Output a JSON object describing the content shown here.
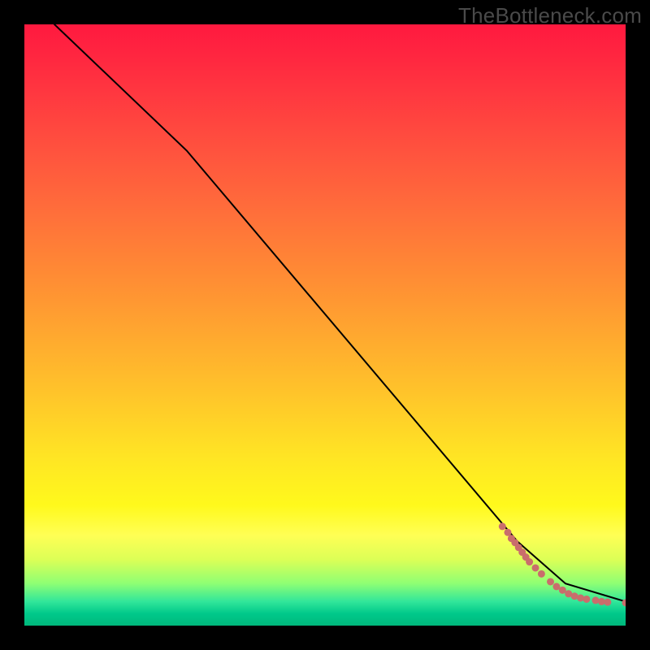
{
  "watermark": "TheBottleneck.com",
  "chart_data": {
    "type": "line",
    "title": "",
    "xlabel": "",
    "ylabel": "",
    "xlim": [
      0,
      100
    ],
    "ylim": [
      0,
      100
    ],
    "grid": false,
    "legend": false,
    "background_gradient": {
      "stops": [
        {
          "pos": 0.0,
          "color": "#ff193f"
        },
        {
          "pos": 0.18,
          "color": "#ff4a3f"
        },
        {
          "pos": 0.42,
          "color": "#ff8c34"
        },
        {
          "pos": 0.72,
          "color": "#ffe524"
        },
        {
          "pos": 0.85,
          "color": "#ffff55"
        },
        {
          "pos": 0.96,
          "color": "#31e69a"
        },
        {
          "pos": 1.0,
          "color": "#00b87c"
        }
      ]
    },
    "series": [
      {
        "name": "curve",
        "style": "line",
        "color": "#000000",
        "x": [
          5,
          27,
          82,
          90,
          100
        ],
        "y": [
          100,
          79,
          14,
          7,
          4
        ]
      },
      {
        "name": "bottleneck-points",
        "style": "scatter",
        "color": "#c96d6c",
        "marker_size": 9,
        "x": [
          79.5,
          80.4,
          81.0,
          81.6,
          82.2,
          82.8,
          83.4,
          84.0,
          85.0,
          86.0,
          87.5,
          88.5,
          89.5,
          90.5,
          91.5,
          92.5,
          93.5,
          95.0,
          96.0,
          97.0,
          100.0
        ],
        "y": [
          16.5,
          15.5,
          14.5,
          13.8,
          13.0,
          12.2,
          11.4,
          10.6,
          9.6,
          8.6,
          7.3,
          6.5,
          5.9,
          5.3,
          4.9,
          4.6,
          4.4,
          4.2,
          4.0,
          3.9,
          3.8
        ]
      }
    ]
  }
}
